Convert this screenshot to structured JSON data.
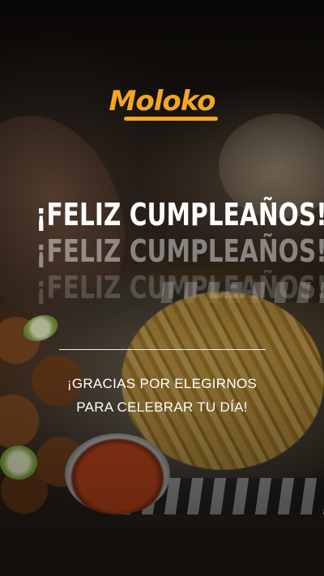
{
  "brand": {
    "logo_text": "Moloko",
    "accent_color": "#f5a623"
  },
  "headline": {
    "line": "¡FELIZ CUMPLEAÑOS!",
    "echo_1": "¡FELIZ CUMPLEAÑOS!",
    "echo_2": "¡FELIZ CUMPLEAÑOS!"
  },
  "message": {
    "line_1": "¡GRACIAS POR ELEGIRNOS",
    "line_2": "PARA CELEBRAR TU DÍA!"
  },
  "colors": {
    "text": "#ffffff",
    "divider": "#f2f2f2"
  }
}
